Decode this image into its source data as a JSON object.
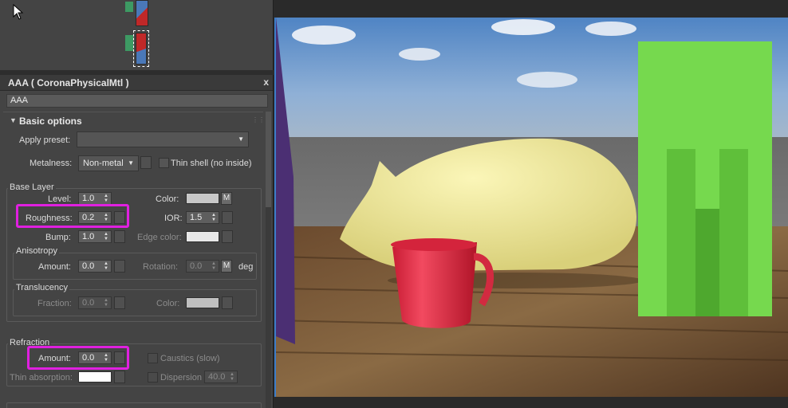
{
  "material": {
    "title": "AAA  ( CoronaPhysicalMtl )",
    "name": "AAA",
    "close_label": "x"
  },
  "basic_options": {
    "header": "Basic options",
    "apply_preset_label": "Apply preset:",
    "apply_preset_value": "",
    "metalness_label": "Metalness:",
    "metalness_value": "Non-metal",
    "thin_shell_label": "Thin shell (no inside)"
  },
  "base_layer": {
    "title": "Base Layer",
    "level_label": "Level:",
    "level_value": "1.0",
    "color_label": "Color:",
    "color_swatch": "#c8c8c8",
    "m_label": "M",
    "roughness_label": "Roughness:",
    "roughness_value": "0.2",
    "ior_label": "IOR:",
    "ior_value": "1.5",
    "bump_label": "Bump:",
    "bump_value": "1.0",
    "edge_color_label": "Edge color:",
    "edge_color_swatch": "#e8e8e8"
  },
  "anisotropy": {
    "title": "Anisotropy",
    "amount_label": "Amount:",
    "amount_value": "0.0",
    "rotation_label": "Rotation:",
    "rotation_value": "0.0",
    "m_label": "M",
    "deg_label": "deg"
  },
  "translucency": {
    "title": "Translucency",
    "fraction_label": "Fraction:",
    "fraction_value": "0.0",
    "color_label": "Color:",
    "color_swatch": "#c0c0c0"
  },
  "refraction": {
    "title": "Refraction",
    "amount_label": "Amount:",
    "amount_value": "0.0",
    "caustics_label": "Caustics (slow)",
    "thin_absorption_label": "Thin absorption:",
    "thin_absorption_swatch": "#ffffff",
    "dispersion_label": "Dispersion",
    "dispersion_value": "40.0"
  },
  "colors": {
    "highlight": "#e020e0",
    "viewport_border": "#3c7cc8"
  }
}
